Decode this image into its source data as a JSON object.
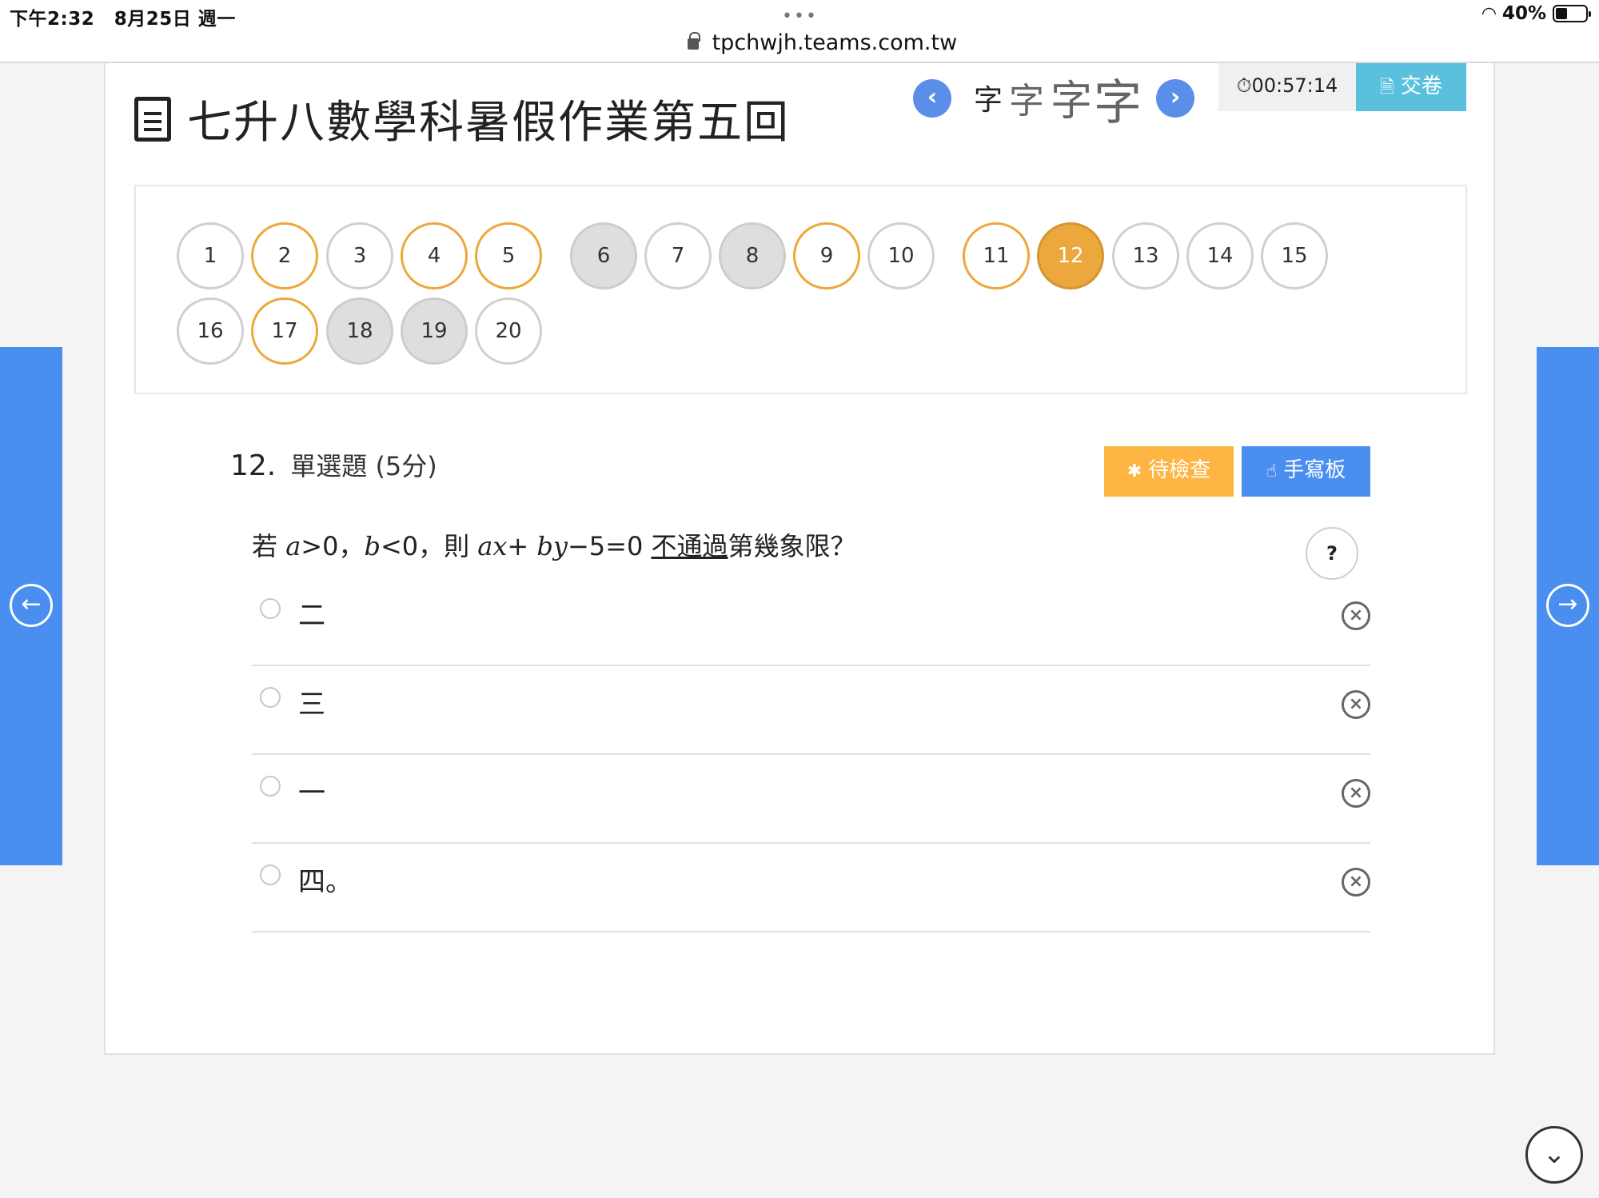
{
  "status_bar": {
    "time": "下午2:32",
    "date": "8月25日 週一",
    "dots": "•••",
    "url": "tpchwjh.teams.com.tw",
    "battery": "40%"
  },
  "header": {
    "title": "七升八數學科暑假作業第五回",
    "font_sizes": [
      "字",
      "字",
      "字",
      "字"
    ],
    "timer": "00:57:14",
    "submit_label": "交卷"
  },
  "question_nav": [
    {
      "label": "1",
      "state": "unanswered"
    },
    {
      "label": "2",
      "state": "answered"
    },
    {
      "label": "3",
      "state": "unanswered"
    },
    {
      "label": "4",
      "state": "answered"
    },
    {
      "label": "5",
      "state": "answered"
    },
    {
      "label": "6",
      "state": "grey"
    },
    {
      "label": "7",
      "state": "unanswered"
    },
    {
      "label": "8",
      "state": "grey"
    },
    {
      "label": "9",
      "state": "answered"
    },
    {
      "label": "10",
      "state": "unanswered"
    },
    {
      "label": "11",
      "state": "answered"
    },
    {
      "label": "12",
      "state": "current"
    },
    {
      "label": "13",
      "state": "unanswered"
    },
    {
      "label": "14",
      "state": "unanswered"
    },
    {
      "label": "15",
      "state": "unanswered"
    },
    {
      "label": "16",
      "state": "unanswered"
    },
    {
      "label": "17",
      "state": "answered"
    },
    {
      "label": "18",
      "state": "grey"
    },
    {
      "label": "19",
      "state": "grey"
    },
    {
      "label": "20",
      "state": "unanswered"
    }
  ],
  "question": {
    "number": "12.",
    "type": "單選題 (5分)",
    "review_label": "待檢查",
    "handwrite_label": "手寫板",
    "text_parts": {
      "p1": "若 ",
      "v1": "a",
      "p2": ">0，",
      "v2": "b",
      "p3": "<0，則 ",
      "v3": "ax",
      "p4": "+ ",
      "v4": "by",
      "p5": "−5=0 ",
      "underline": "不通過",
      "p6": "第幾象限？"
    },
    "help_label": "?",
    "options": [
      {
        "label": "二"
      },
      {
        "label": "三"
      },
      {
        "label": "一"
      },
      {
        "label": "四。"
      }
    ]
  },
  "colors": {
    "accent_blue": "#4a8ef0",
    "answered_orange": "#eca83c",
    "review_orange": "#ffb543",
    "submit_cyan": "#5bc0de"
  }
}
